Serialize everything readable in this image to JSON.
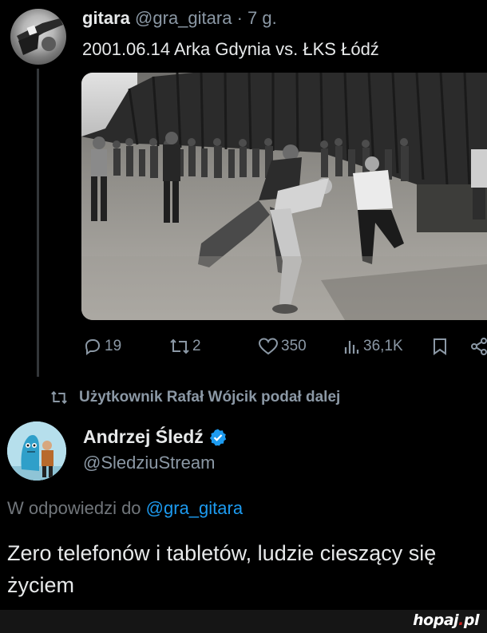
{
  "tweet1": {
    "name": "gitara",
    "handle": "@gra_gitara",
    "separator": "·",
    "time": "7 g.",
    "text": "2001.06.14 Arka Gdynia vs. ŁKS Łódź",
    "stats": {
      "replies": "19",
      "reposts": "2",
      "likes": "350",
      "views": "36,1K"
    }
  },
  "repost_line": {
    "text": "Użytkownik Rafał Wójcik podał dalej"
  },
  "tweet2": {
    "name": "Andrzej Śledź",
    "verified": true,
    "handle": "@SledziuStream",
    "reply_prefix": "W odpowiedzi do",
    "reply_mention": "@gra_gitara",
    "text": "Zero telefonów i tabletów, ludzie cieszący się życiem"
  },
  "watermark": {
    "brand": "hopaj",
    "dot": ".",
    "tld": "pl"
  },
  "colors": {
    "background": "#000000",
    "text": "#e7e9ea",
    "muted": "#8b98a5",
    "accent": "#1d9bf0"
  },
  "icons": [
    "reply-icon",
    "repost-icon",
    "like-icon",
    "views-icon",
    "bookmark-icon",
    "share-icon",
    "verified-icon"
  ]
}
